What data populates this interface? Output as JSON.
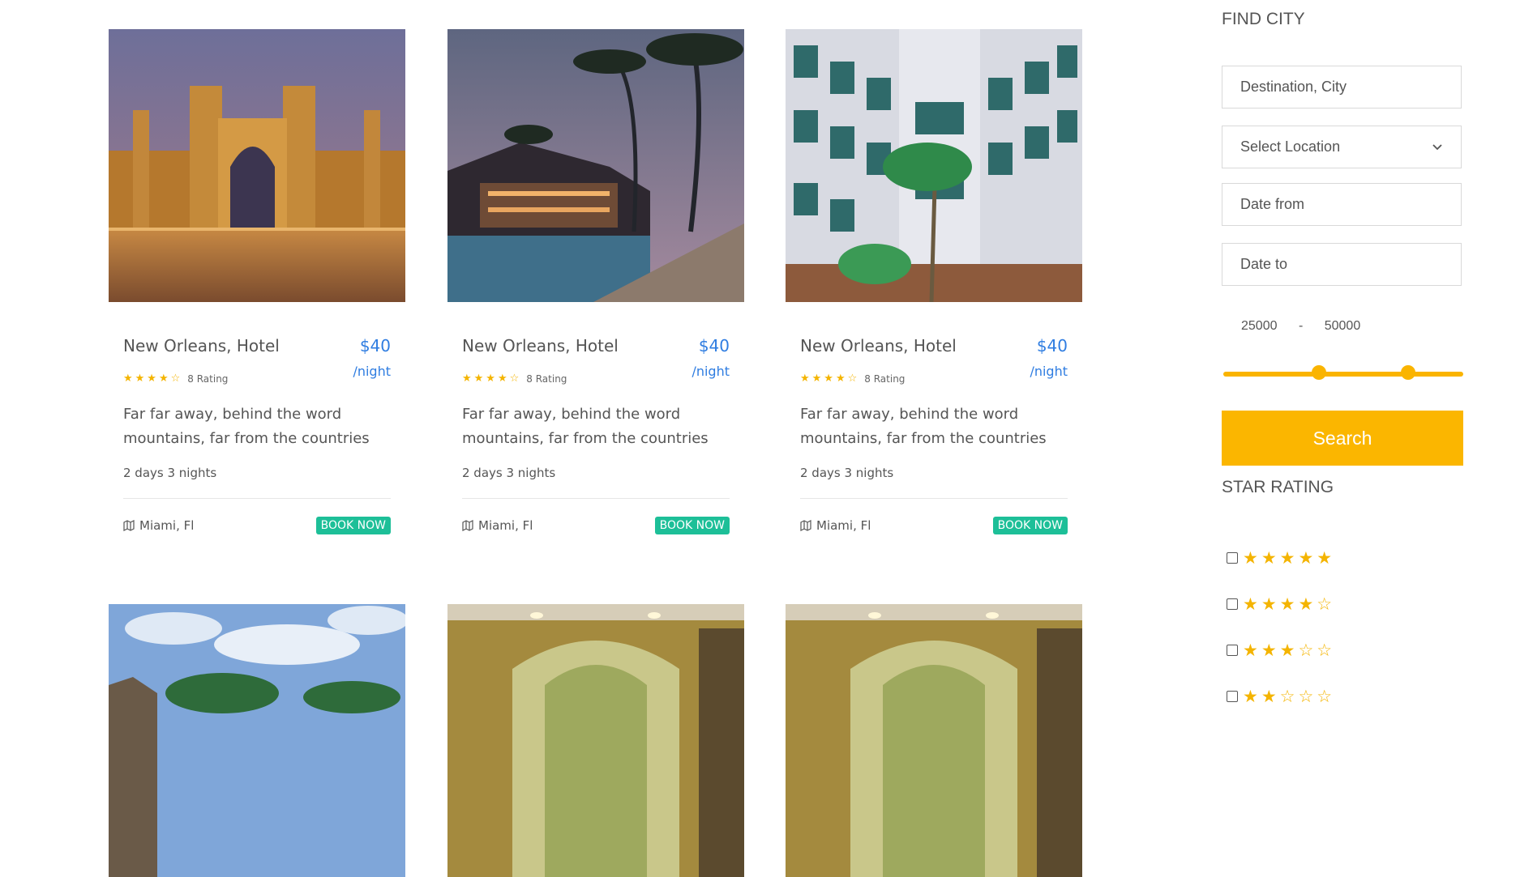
{
  "cards": [
    {
      "title": "New Orleans, Hotel",
      "price": "$40",
      "per": "/night",
      "stars": "★★★★☆",
      "rating_text": "8 Rating",
      "desc": "Far far away, behind the word mountains, far from the countries",
      "duration": "2 days 3 nights",
      "location": "Miami, Fl",
      "book_label": "BOOK NOW"
    },
    {
      "title": "New Orleans, Hotel",
      "price": "$40",
      "per": "/night",
      "stars": "★★★★☆",
      "rating_text": "8 Rating",
      "desc": "Far far away, behind the word mountains, far from the countries",
      "duration": "2 days 3 nights",
      "location": "Miami, Fl",
      "book_label": "BOOK NOW"
    },
    {
      "title": "New Orleans, Hotel",
      "price": "$40",
      "per": "/night",
      "stars": "★★★★☆",
      "rating_text": "8 Rating",
      "desc": "Far far away, behind the word mountains, far from the countries",
      "duration": "2 days 3 nights",
      "location": "Miami, Fl",
      "book_label": "BOOK NOW"
    }
  ],
  "sidebar": {
    "find_city_title": "FIND CITY",
    "destination_placeholder": "Destination, City",
    "select_location": "Select Location",
    "date_from_placeholder": "Date from",
    "date_to_placeholder": "Date to",
    "price_min": "25000",
    "price_sep": "-",
    "price_max": "50000",
    "price_min_fraction": 0.4,
    "price_max_fraction": 0.77,
    "search_label": "Search",
    "star_rating_title": "STAR RATING",
    "star_rows": [
      "★★★★★",
      "★★★★☆",
      "★★★☆☆",
      "★★☆☆☆"
    ]
  },
  "colors": {
    "accent": "#fbb600",
    "price": "#2f7de1",
    "book": "#1dbf98",
    "star": "#f4b400"
  },
  "icons": {
    "map": "map-icon",
    "chevron": "chevron-down-icon"
  }
}
